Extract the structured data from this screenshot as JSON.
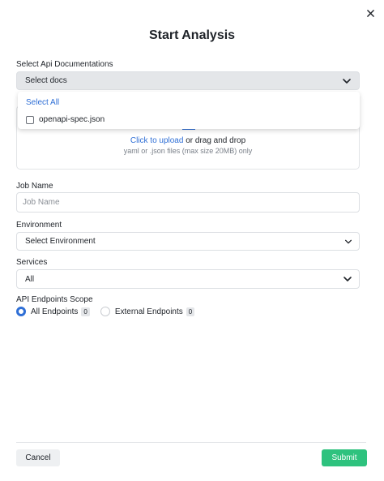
{
  "modal": {
    "title": "Start Analysis"
  },
  "api_docs": {
    "label": "Select Api Documentations",
    "select_placeholder": "Select docs",
    "dropdown": {
      "select_all": "Select All",
      "options": [
        {
          "label": "openapi-spec.json",
          "checked": false
        }
      ]
    },
    "upload": {
      "link_text": "Click to upload",
      "rest_text": " or drag and drop",
      "hint": "yaml or .json files (max size 20MB) only"
    }
  },
  "job_name": {
    "label": "Job Name",
    "placeholder": "Job Name",
    "value": ""
  },
  "environment": {
    "label": "Environment",
    "selected": "Select Environment"
  },
  "services": {
    "label": "Services",
    "selected": "All"
  },
  "scope": {
    "label": "API Endpoints Scope",
    "options": [
      {
        "label": "All Endpoints",
        "count": "0",
        "checked": true
      },
      {
        "label": "External Endpoints",
        "count": "0",
        "checked": false
      }
    ]
  },
  "footer": {
    "cancel_label": "Cancel",
    "submit_label": "Submit"
  },
  "colors": {
    "accent": "#2f6fd6",
    "submit": "#2ec27e"
  },
  "icons": {
    "close": "close-icon",
    "chevron": "chevron-down-icon",
    "upload": "upload-icon"
  }
}
